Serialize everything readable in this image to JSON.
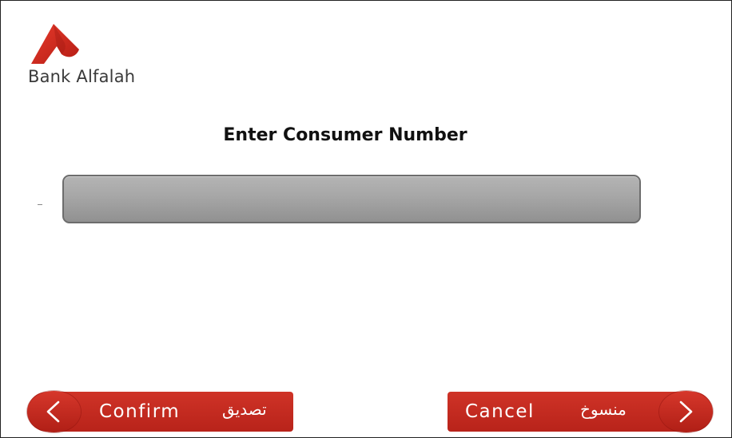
{
  "brand": {
    "name": "Bank Alfalah",
    "primary_color": "#c42b20",
    "logo_icon": "bank-alfalah-mark"
  },
  "screen": {
    "prompt": "Enter Consumer Number",
    "input_value": ""
  },
  "buttons": {
    "confirm": {
      "label": "Confirm",
      "label_ar": "تصديق",
      "icon": "chevron-left-icon"
    },
    "cancel": {
      "label": "Cancel",
      "label_ar": "منسوخ",
      "icon": "chevron-right-icon"
    }
  }
}
